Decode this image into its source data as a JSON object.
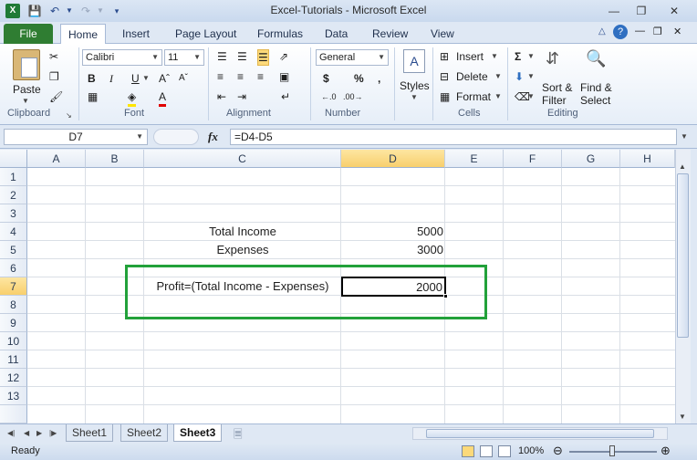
{
  "window": {
    "title": "Excel-Tutorials  -  Microsoft Excel"
  },
  "ribbon": {
    "file_tab": "File",
    "tabs": [
      "Home",
      "Insert",
      "Page Layout",
      "Formulas",
      "Data",
      "Review",
      "View"
    ],
    "clipboard": {
      "paste": "Paste",
      "label": "Clipboard"
    },
    "font": {
      "name": "Calibri",
      "size": "11",
      "label": "Font",
      "bold": "B",
      "italic": "I",
      "underline": "U"
    },
    "alignment": {
      "label": "Alignment"
    },
    "number": {
      "format": "General",
      "label": "Number",
      "currency": "$",
      "percent": "%",
      "comma": ","
    },
    "styles": {
      "label": "Styles"
    },
    "cells": {
      "insert": "Insert",
      "delete": "Delete",
      "format": "Format",
      "label": "Cells"
    },
    "editing": {
      "sort_filter_1": "Sort &",
      "sort_filter_2": "Filter",
      "find_select_1": "Find &",
      "find_select_2": "Select",
      "label": "Editing"
    }
  },
  "formula_bar": {
    "name_box": "D7",
    "fx": "fx",
    "formula": "=D4-D5"
  },
  "grid": {
    "columns": [
      "A",
      "B",
      "C",
      "D",
      "E",
      "F",
      "G",
      "H"
    ],
    "rows": [
      "1",
      "2",
      "3",
      "4",
      "5",
      "6",
      "7",
      "8",
      "9",
      "10",
      "11",
      "12",
      "13"
    ],
    "cells": {
      "C4": "Total Income",
      "D4": "5000",
      "C5": "Expenses",
      "D5": "3000",
      "C7": "Profit=(Total Income - Expenses)",
      "D7": "2000"
    },
    "highlight_color": "#22a13a",
    "active_header_color": "#f8cf6d"
  },
  "sheets": {
    "tabs": [
      "Sheet1",
      "Sheet2",
      "Sheet3"
    ],
    "active": "Sheet3"
  },
  "status": {
    "state": "Ready",
    "zoom": "100%"
  }
}
